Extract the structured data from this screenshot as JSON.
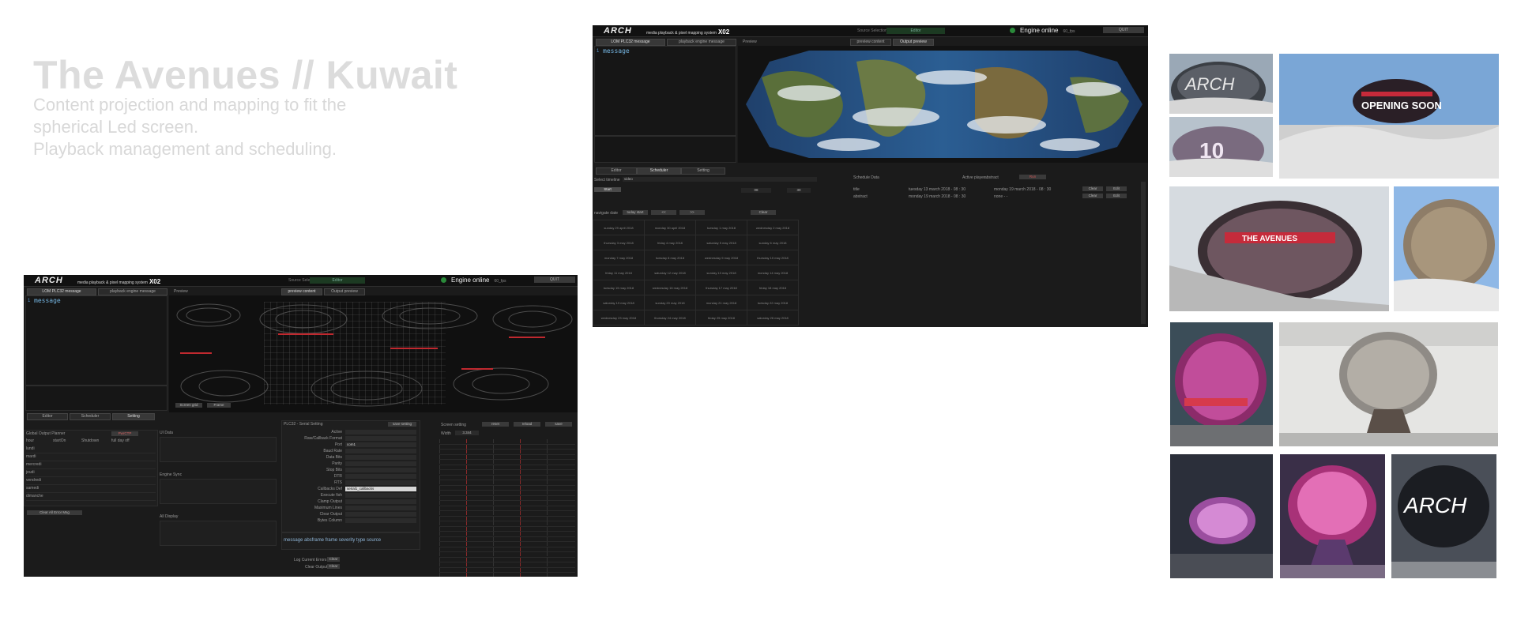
{
  "page": {
    "title": "The Avenues // Kuwait",
    "subtitle_lines": [
      "Content projection and mapping to fit the",
      "spherical Led screen.",
      "Playback management and scheduling."
    ]
  },
  "app": {
    "logo": "ARCH",
    "system_name": "media playback & pixel mapping system",
    "version": "X02",
    "source_label": "Source Selection",
    "source_value": "Editor",
    "engine_status": "Engine online",
    "fps": "60_fps",
    "quit_label": "QUIT",
    "tabs_top": [
      "LOM PLC32 message",
      "playback engine message",
      "Preview"
    ],
    "preview_tabs": [
      "preview content",
      "Output preview"
    ],
    "editor_line": "1",
    "editor_text": "message",
    "mode_tabs": [
      "Editor",
      "Scheduler",
      "Setting"
    ]
  },
  "window_left": {
    "panel_global": "Global Output Planner",
    "auto_label": "PwrCTP",
    "cols": [
      "hour",
      "startOn",
      "Shutdown",
      "full day off"
    ],
    "days": [
      "lundi",
      "mardi",
      "mercredi",
      "jeudi",
      "vendredi",
      "samedi",
      "dimanche"
    ],
    "clear_btn": "Clear All Error Msg",
    "sec_a": "UI Data",
    "sec_b": "Engine Sync",
    "sec_c": "All Display",
    "serial_title": "PLC32 - Serial Setting",
    "save_setting": "save setting",
    "serial_fields": [
      "Active",
      "Raw/Callback Format",
      "Port",
      "Baud Rate",
      "Data Bits",
      "Parity",
      "Stop Bits",
      "DTR",
      "RTS",
      "Callbacks Def",
      "Execute fish",
      "Clamp Output",
      "Maximum Lines",
      "Clear Output",
      "Bytes Column"
    ],
    "port_value": "com1",
    "callback_value": "serial1_callbacks",
    "log_header": "message  absframe  frame  severity  type  source",
    "log_buttons": [
      "Log Current Errors",
      "Clear Output"
    ],
    "screen_setting": "Screen setting",
    "screen_buttons": [
      "reset",
      "reload",
      "save"
    ],
    "width_label": "Width",
    "width_value": "3.344",
    "preview_btns": [
      "Screen grid",
      "Frame"
    ]
  },
  "window_right": {
    "select_timeline": "Select timeline",
    "timeline_value": "video",
    "start": "Start",
    "navigate": "navigate date",
    "today": "today start",
    "prev": "<<",
    "next": ">>",
    "clear": "Clear",
    "calendar": [
      [
        "sunday 29 april 2018",
        "monday 30 april 2018",
        "tuesday 1 may 2018",
        "wednesday 2 may 2018"
      ],
      [
        "thursday 3 may 2018",
        "friday 4 may 2018",
        "saturday 5 may 2018",
        "sunday 6 may 2018"
      ],
      [
        "monday 7 may 2018",
        "tuesday 8 may 2018",
        "wednesday 9 may 2018",
        "thursday 10 may 2018"
      ],
      [
        "friday 11 may 2018",
        "saturday 12 may 2018",
        "sunday 13 may 2018",
        "monday 14 may 2018"
      ],
      [
        "tuesday 15 may 2018",
        "wednesday 16 may 2018",
        "thursday 17 may 2018",
        "friday 18 may 2018"
      ],
      [
        "saturday 19 may 2018",
        "sunday 20 may 2018",
        "monday 21 may 2018",
        "tuesday 22 may 2018"
      ],
      [
        "wednesday 23 may 2018",
        "thursday 24 may 2018",
        "friday 25 may 2018",
        "saturday 26 may 2018"
      ]
    ],
    "schedule_head": "Schedule Data",
    "active_label": "Active player",
    "active_value": "abstract",
    "schedule_rows": [
      {
        "name": "title",
        "day": "tuesday 13 march 2018 - 08 : 30",
        "to": "monday 19 march 2018 - 08 : 30"
      },
      {
        "name": "abstract",
        "day": "monday 19 march 2018 - 08 : 30",
        "to": "none - -"
      }
    ],
    "row_buttons": [
      "Clear",
      "Edit"
    ]
  }
}
